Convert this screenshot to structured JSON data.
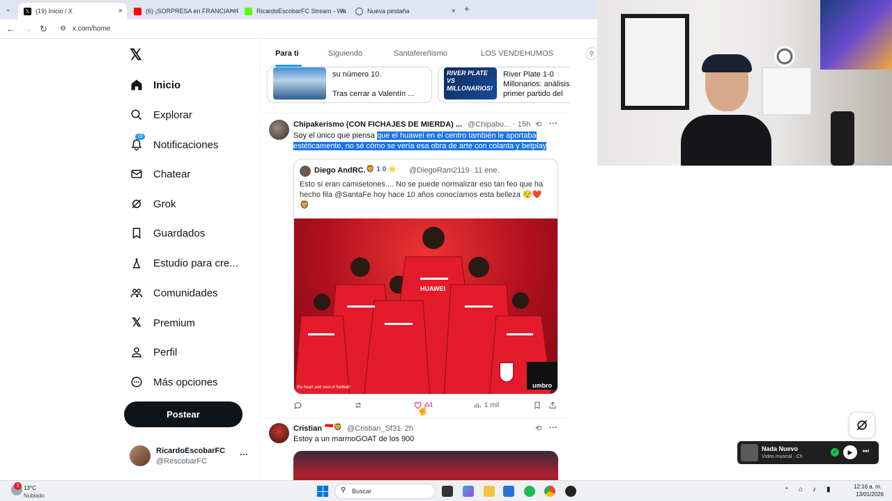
{
  "browser": {
    "tabs": [
      {
        "title": "(19) Inicio / X",
        "close": "×"
      },
      {
        "title": "(6) ¡SORPRESA en FRANCIA! #P",
        "close": "×"
      },
      {
        "title": "RicardoEscobarFC Stream - Wa",
        "close": "×"
      },
      {
        "title": "Nueva pestaña",
        "close": "×"
      }
    ],
    "new_tab": "+",
    "url": "x.com/home"
  },
  "sidebar": {
    "items": [
      {
        "label": "Inicio",
        "icon": "home-icon"
      },
      {
        "label": "Explorar",
        "icon": "search-icon"
      },
      {
        "label": "Notificaciones",
        "icon": "bell-icon",
        "badge": "19"
      },
      {
        "label": "Chatear",
        "icon": "mail-icon"
      },
      {
        "label": "Grok",
        "icon": "grok-icon"
      },
      {
        "label": "Guardados",
        "icon": "bookmark-icon"
      },
      {
        "label": "Estudio para cre...",
        "icon": "studio-icon"
      },
      {
        "label": "Comunidades",
        "icon": "communities-icon"
      },
      {
        "label": "Premium",
        "icon": "x-icon"
      },
      {
        "label": "Perfil",
        "icon": "person-icon"
      },
      {
        "label": "Más opciones",
        "icon": "more-icon"
      }
    ],
    "post_label": "Postear",
    "account": {
      "name": "RicardoEscobarFC",
      "handle": "@RescobarFC",
      "more": "···"
    }
  },
  "feed": {
    "tabs": [
      "Para ti",
      "Siguiendo",
      "Santafereñismo",
      "LOS VENDEHUMOS"
    ],
    "cards": [
      {
        "line1": "su número 10.",
        "line2": "Tras cerrar a Valentín ..."
      },
      {
        "thumb_text": "RIVER PLATE VS MILLONARIOS!",
        "line1": "River Plate 1-0",
        "line2": "Millonarios: análisis",
        "line3": "primer partido del"
      }
    ],
    "tweet1": {
      "name": "Chipakerismo (CON FICHAJES DE MIERDA) ...",
      "handle": "@Chipabu...",
      "time": "· 15h",
      "text_plain": "Soy el único que piensa ",
      "text_highlight_1": "que el huawei en el centro también le aportaba",
      "text_highlight_2": "estéticamente, no sé cómo se vería esa obra de arte con colanta y betplay",
      "quote": {
        "name": "Diego AndRC.",
        "badges": "🦁 1 0 ⭐",
        "handle": "@DiegoRam2119",
        "time": "· 11 ene.",
        "text": "Esto si eran camisetones.... No se puede normalizar eso tan feo que ha hecho fila @SantaFe hoy hace 10 años conocíamos esta belleza 😌❤️ 🦁",
        "image_caption": "the heart and soul of football",
        "sponsor": "HUAWEI",
        "brand": "umbro"
      },
      "likes": "64",
      "views": "1 mil"
    },
    "tweet2": {
      "name": "Cristian",
      "handle": "@Cristian_Sf31",
      "time": "· 2h",
      "text": "Estoy a un marmoGOAT de los 900"
    }
  },
  "media_player": {
    "title": "Nada Nuevo",
    "subtitle": "Video musical · Ch"
  },
  "taskbar": {
    "weather_temp": "13°C",
    "weather_desc": "Nublado",
    "weather_badge": "3",
    "search": "Buscar",
    "time": "12:16 a. m.",
    "date": "13/01/2026"
  },
  "colors": {
    "accent": "#1d9bf0",
    "like": "#f91880",
    "highlight": "#1a73e8",
    "club_red": "#c8102e"
  }
}
